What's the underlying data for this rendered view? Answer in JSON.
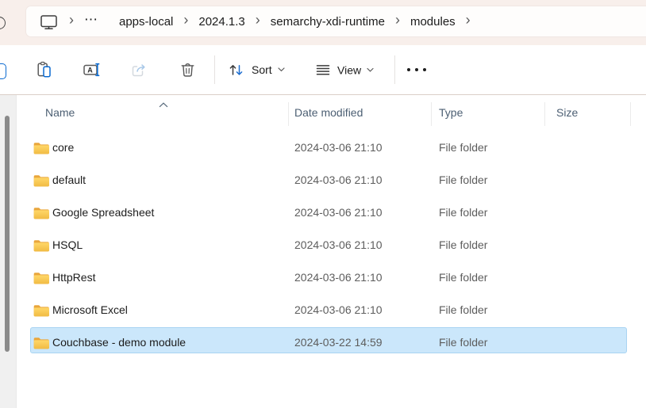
{
  "breadcrumb": {
    "root_icon": "this-pc-monitor-icon",
    "overflow": "⋯",
    "separator": "›",
    "items": [
      "apps-local",
      "2024.1.3",
      "semarchy-xdi-runtime",
      "modules"
    ]
  },
  "toolbar": {
    "buttons": [
      "copy-icon-partial",
      "paste-icon",
      "rename-icon",
      "share-icon-disabled",
      "delete-icon",
      "sort-icon",
      "view-icon",
      "more-options-ellipsis-icon"
    ],
    "sort_label": "Sort",
    "view_label": "View"
  },
  "files": {
    "columns": {
      "name": "Name",
      "date_modified": "Date modified",
      "type": "Type",
      "size": "Size"
    },
    "sort": {
      "column": "Name",
      "direction": "ascending"
    },
    "rows": [
      {
        "name": "core",
        "date_modified": "2024-03-06 21:10",
        "type": "File folder",
        "size": "",
        "selected": false
      },
      {
        "name": "default",
        "date_modified": "2024-03-06 21:10",
        "type": "File folder",
        "size": "",
        "selected": false
      },
      {
        "name": "Google Spreadsheet",
        "date_modified": "2024-03-06 21:10",
        "type": "File folder",
        "size": "",
        "selected": false
      },
      {
        "name": "HSQL",
        "date_modified": "2024-03-06 21:10",
        "type": "File folder",
        "size": "",
        "selected": false
      },
      {
        "name": "HttpRest",
        "date_modified": "2024-03-06 21:10",
        "type": "File folder",
        "size": "",
        "selected": false
      },
      {
        "name": "Microsoft Excel",
        "date_modified": "2024-03-06 21:10",
        "type": "File folder",
        "size": "",
        "selected": false
      },
      {
        "name": "Couchbase - demo module",
        "date_modified": "2024-03-22 14:59",
        "type": "File folder",
        "size": "",
        "selected": true
      }
    ]
  },
  "colors": {
    "titlebar_bg": "#f8efeb",
    "accent_blue": "#0b6ad0",
    "selection_fill": "#cbe7fb",
    "selection_border": "#a9d4f2",
    "folder_back": "#E9A63C",
    "folder_front_top": "#FFD768",
    "folder_front_bottom": "#F1BB43",
    "header_text": "#4c5f73",
    "secondary_text": "#5d5d5d"
  }
}
